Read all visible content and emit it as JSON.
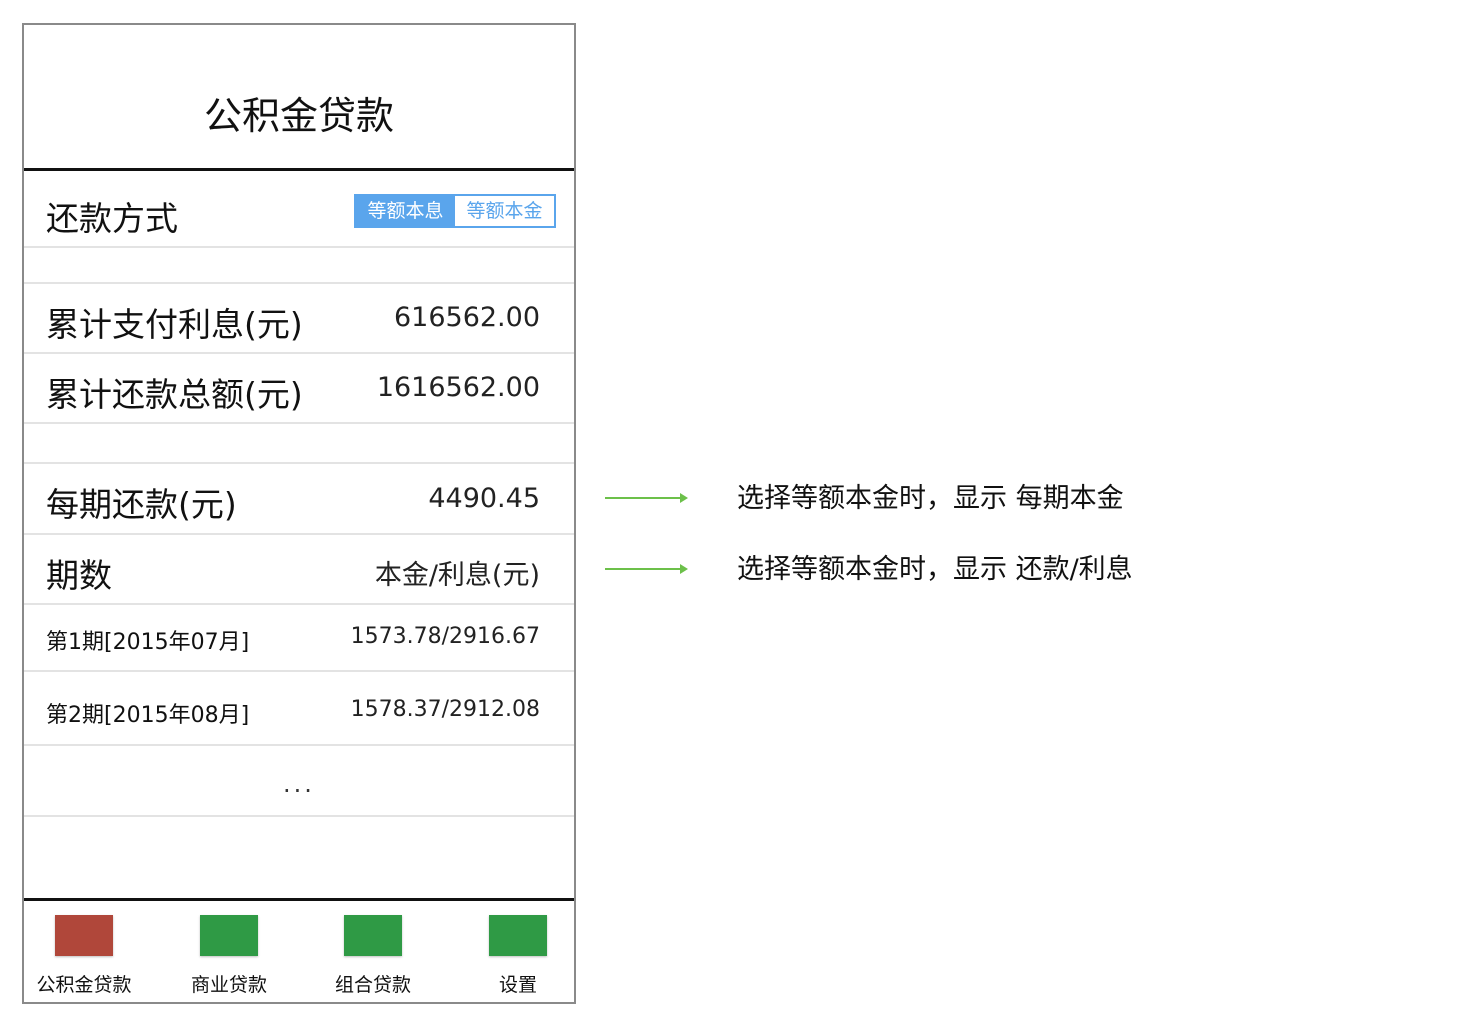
{
  "nav": {
    "title": "公积金贷款"
  },
  "repayment": {
    "label": "还款方式",
    "options": [
      "等额本息",
      "等额本金"
    ],
    "selected": "等额本息"
  },
  "summary": {
    "total_interest_label": "累计支付利息(元)",
    "total_interest_value": "616562.00",
    "total_repay_label": "累计还款总额(元)",
    "total_repay_value": "1616562.00"
  },
  "schedule": {
    "per_period_label": "每期还款(元)",
    "per_period_value": "4490.45",
    "header_label": "期数",
    "header_value": "本金/利息(元)",
    "rows": [
      {
        "period": "第1期[2015年07月]",
        "amount": "1573.78/2916.67"
      },
      {
        "period": "第2期[2015年08月]",
        "amount": "1578.37/2912.08"
      }
    ],
    "ellipsis": "..."
  },
  "tabs": [
    {
      "label": "公积金贷款",
      "color": "#b0473a",
      "icon": "loan-fund-icon"
    },
    {
      "label": "商业贷款",
      "color": "#2f9a45",
      "icon": "commercial-loan-icon"
    },
    {
      "label": "组合贷款",
      "color": "#2f9a45",
      "icon": "combined-loan-icon"
    },
    {
      "label": "设置",
      "color": "#2f9a45",
      "icon": "settings-icon"
    }
  ],
  "annotations": [
    "选择等额本金时，显示 每期本金",
    "选择等额本金时，显示 还款/利息"
  ],
  "colors": {
    "accent": "#5aa5ec",
    "arrow": "#6cc04a",
    "active_tab": "#b0473a",
    "tab": "#2f9a45"
  }
}
